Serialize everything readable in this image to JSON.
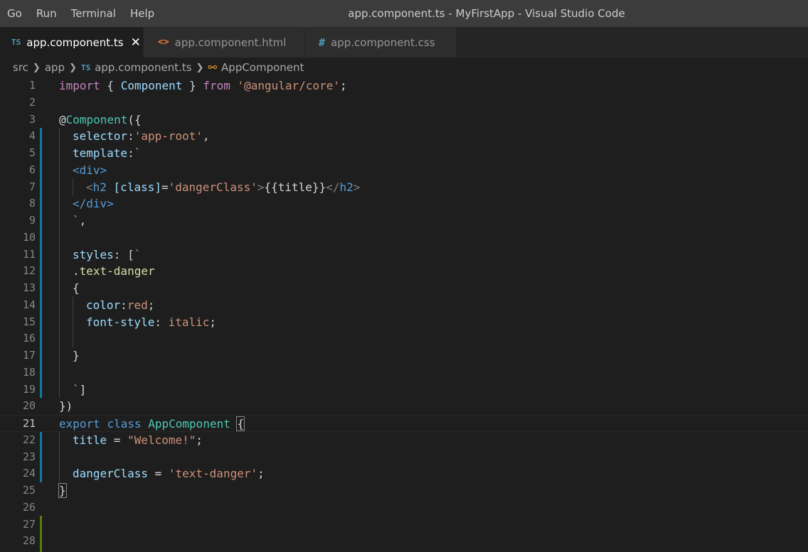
{
  "menu": [
    "Go",
    "Run",
    "Terminal",
    "Help"
  ],
  "window_title": "app.component.ts - MyFirstApp - Visual Studio Code",
  "tabs": [
    {
      "icon": "TS",
      "label": "app.component.ts",
      "close": "✕"
    },
    {
      "icon": "<>",
      "label": "app.component.html"
    },
    {
      "icon": "#",
      "label": "app.component.css"
    }
  ],
  "breadcrumbs": {
    "src": "src",
    "app": "app",
    "file_icon": "TS",
    "file": "app.component.ts",
    "symbol": "AppComponent"
  },
  "editor": {
    "current_line": 21,
    "line_numbers": [
      "1",
      "2",
      "3",
      "4",
      "5",
      "6",
      "7",
      "8",
      "9",
      "10",
      "11",
      "12",
      "13",
      "14",
      "15",
      "16",
      "17",
      "18",
      "19",
      "20",
      "21",
      "22",
      "23",
      "24",
      "25",
      "26",
      "27",
      "28"
    ],
    "code": {
      "l1": [
        "import",
        " { ",
        "Component",
        " } ",
        "from",
        " ",
        "'@angular/core'",
        ";"
      ],
      "l3": [
        "@",
        "Component",
        "({"
      ],
      "l4": [
        "selector",
        ":",
        "'app-root'",
        ","
      ],
      "l5": [
        "template",
        ":",
        "`"
      ],
      "l6": [
        "<div>"
      ],
      "l7": [
        "<",
        "h2",
        " ",
        "[class]",
        "=",
        "'dangerClass'",
        ">",
        "{{title}}",
        "</",
        "h2",
        ">"
      ],
      "l8": [
        "</div>"
      ],
      "l9": [
        "`",
        ","
      ],
      "l11": [
        "styles",
        ": [",
        "`"
      ],
      "l12": [
        ".text-danger"
      ],
      "l13": [
        "{"
      ],
      "l14": [
        "color",
        ":",
        "red",
        ";"
      ],
      "l15": [
        "font-style",
        ": ",
        "italic",
        ";"
      ],
      "l17": [
        "}"
      ],
      "l19": [
        "`",
        "]"
      ],
      "l20": [
        "})"
      ],
      "l21": [
        "export",
        " ",
        "class",
        " ",
        "AppComponent",
        " ",
        "{"
      ],
      "l22": [
        "title",
        " = ",
        "\"Welcome!\"",
        ";"
      ],
      "l24": [
        "dangerClass",
        " = ",
        "'text-danger'",
        ";"
      ],
      "l25": [
        "}"
      ]
    }
  },
  "colors": {
    "keyword": "#c586c0",
    "storage": "#569cd6",
    "type": "#4ec9b0",
    "variable": "#9cdcfe",
    "string": "#ce9178",
    "modified_gutter": "#0c7d9d",
    "added_gutter": "#587c0c"
  }
}
